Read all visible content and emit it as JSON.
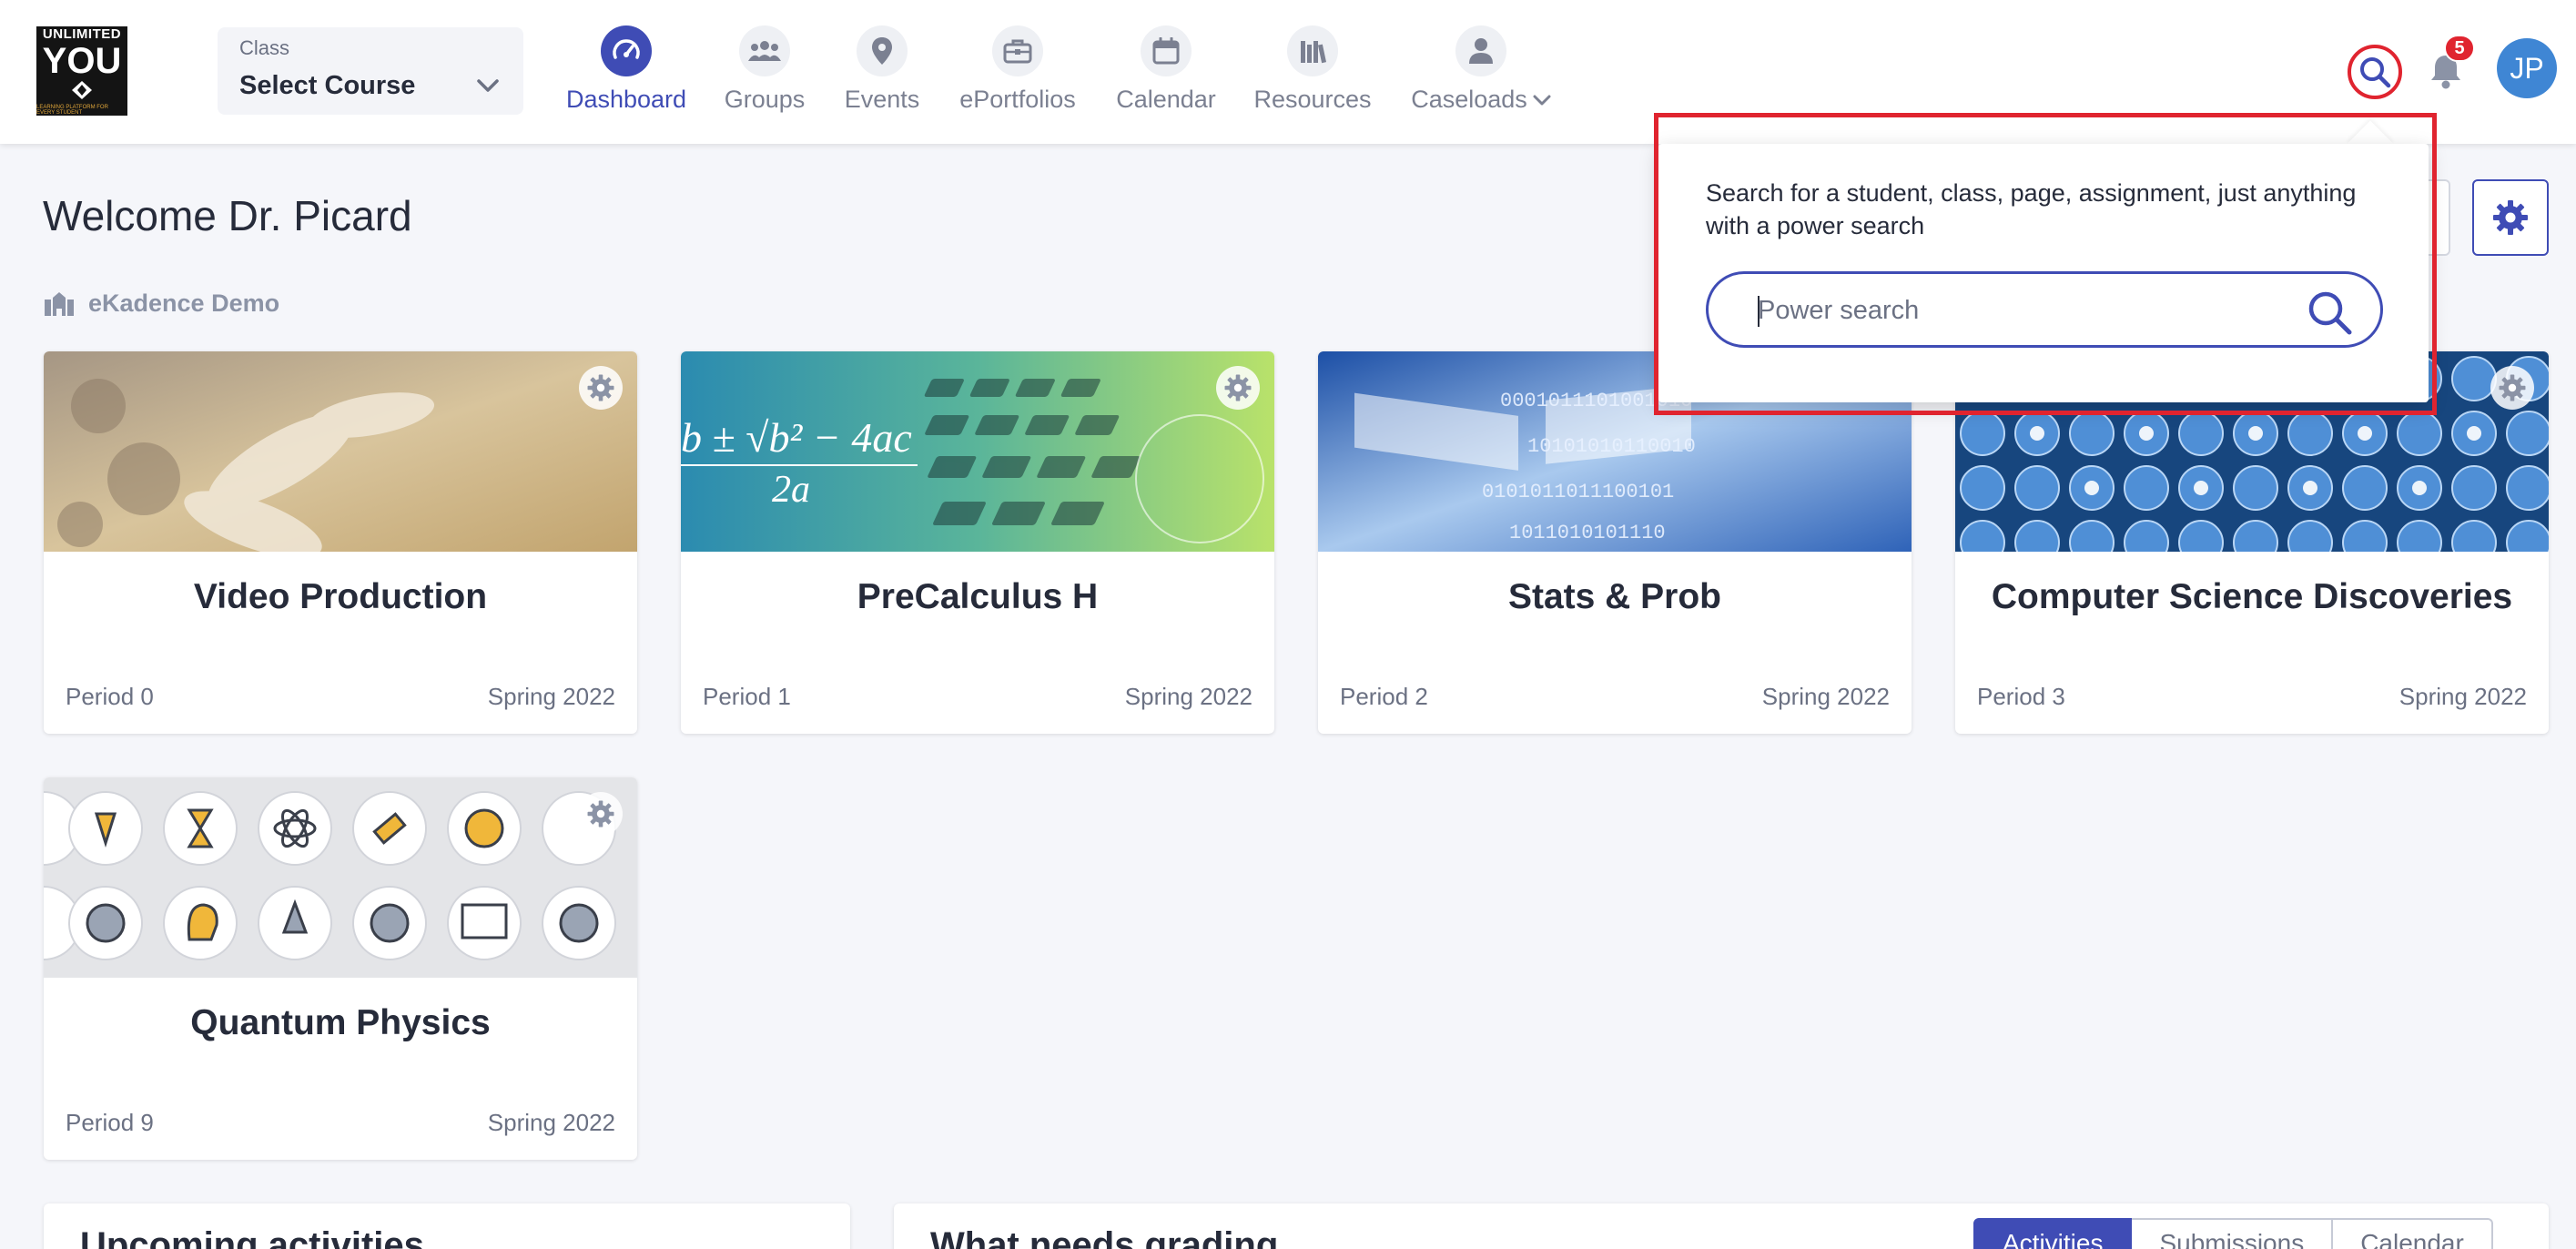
{
  "app": {
    "logo": {
      "line1": "UNLIMITED",
      "line2": "YOU",
      "tagline": "LEARNING PLATFORM FOR EVERY STUDENT"
    }
  },
  "class_select": {
    "caption": "Class",
    "value": "Select Course"
  },
  "nav": {
    "items": [
      {
        "label": "Dashboard",
        "icon": "speedometer-icon",
        "active": true
      },
      {
        "label": "Groups",
        "icon": "people-icon",
        "active": false
      },
      {
        "label": "Events",
        "icon": "map-pin-icon",
        "active": false
      },
      {
        "label": "ePortfolios",
        "icon": "briefcase-icon",
        "active": false
      },
      {
        "label": "Calendar",
        "icon": "calendar-icon",
        "active": false
      },
      {
        "label": "Resources",
        "icon": "books-icon",
        "active": false
      },
      {
        "label": "Caseloads",
        "icon": "user-icon",
        "active": false
      }
    ]
  },
  "header": {
    "notifications_count": "5",
    "avatar_initials": "JP",
    "welcome": "Welcome Dr. Picard",
    "organization": "eKadence Demo"
  },
  "courses": [
    {
      "title": "Video Production",
      "period": "Period 0",
      "term": "Spring 2022"
    },
    {
      "title": "PreCalculus H",
      "period": "Period 1",
      "term": "Spring 2022"
    },
    {
      "title": "Stats & Prob",
      "period": "Period 2",
      "term": "Spring 2022"
    },
    {
      "title": "Computer Science Discoveries",
      "period": "Period 3",
      "term": "Spring 2022"
    },
    {
      "title": "Quantum Physics",
      "period": "Period 9",
      "term": "Spring 2022"
    }
  ],
  "panels": {
    "upcoming": {
      "title": "Upcoming activities"
    },
    "grading": {
      "title": "What needs grading",
      "tabs": [
        "Activities",
        "Submissions",
        "Calendar"
      ],
      "active_tab": "Activities"
    }
  },
  "power_search": {
    "description": "Search for a student, class, page, assignment, just anything with a power search",
    "placeholder": "Power search",
    "value": ""
  },
  "colors": {
    "accent": "#3f4cb5",
    "alert": "#e0242f",
    "avatar": "#3f86d4"
  }
}
